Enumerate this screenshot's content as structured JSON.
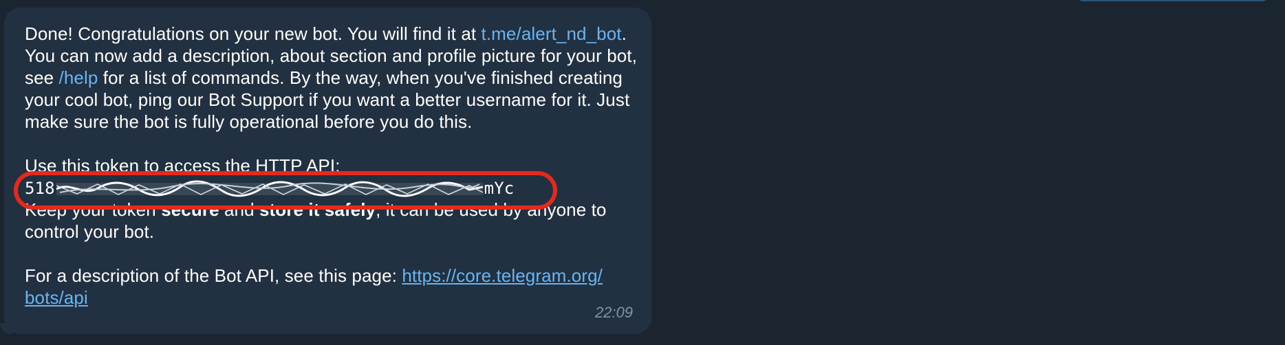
{
  "message": {
    "p1_a": "Done! Congratulations on your new bot. You will find it at ",
    "p1_link": "t.me/​alert_nd_bot",
    "p1_b": ". You can now add a description, about section and profile picture for your bot, see ",
    "p1_cmd": "/help",
    "p1_c": " for a list of commands. By the way, when you've finished creating your cool bot, ping our Bot Support if you want a better username for it. Just make sure the bot is fully operational before you do this.",
    "p2": "Use this token to access the HTTP API:",
    "token_prefix": "518",
    "token_suffix": "mYc",
    "p3_a": "Keep your token ",
    "p3_b1": "secure",
    "p3_mid": " and ",
    "p3_b2": "store it safely",
    "p3_c": ", it can be used by anyone to control your bot.",
    "p4_a": "For a description of the Bot API, see this page: ",
    "p4_link": "https://core.telegram.org/​bots/api",
    "time": "22:09"
  },
  "colors": {
    "background": "#1b2530",
    "bubble": "#213141",
    "link": "#6ab4f2",
    "highlight": "#e52a1d",
    "timestamp": "#8094a6"
  },
  "icons": {
    "redaction": "scribble-redaction-icon"
  }
}
